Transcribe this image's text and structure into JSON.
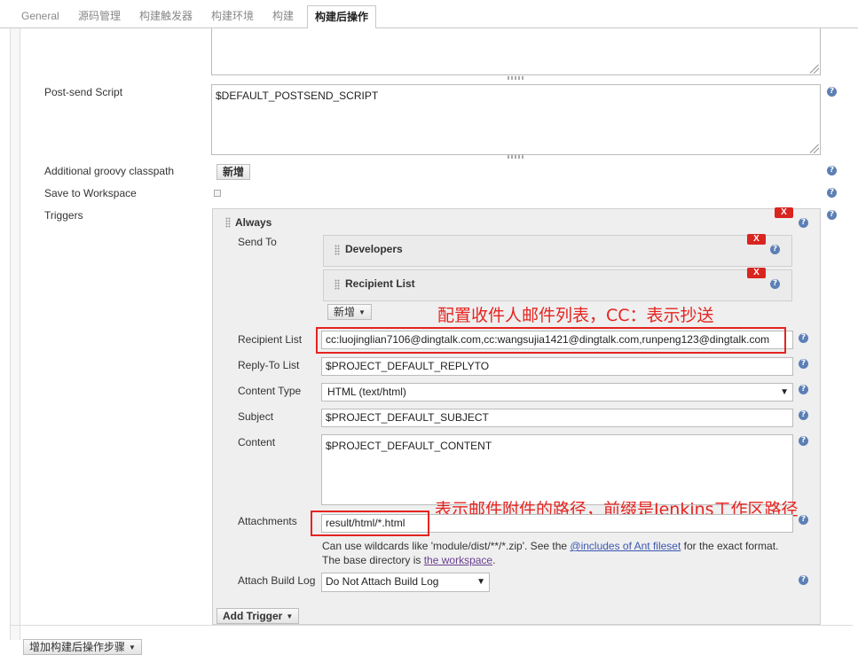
{
  "tabs": [
    {
      "label": "General"
    },
    {
      "label": "源码管理"
    },
    {
      "label": "构建触发器"
    },
    {
      "label": "构建环境"
    },
    {
      "label": "构建"
    },
    {
      "label": "构建后操作"
    }
  ],
  "fields": {
    "post_send_label": "Post-send Script",
    "post_send_value": "$DEFAULT_POSTSEND_SCRIPT",
    "groovy_label": "Additional groovy classpath",
    "groovy_add": "新增",
    "save_ws_label": "Save to Workspace",
    "triggers_label": "Triggers"
  },
  "trigger": {
    "name": "Always",
    "send_to_label": "Send To",
    "send_to": [
      "Developers",
      "Recipient List"
    ],
    "add_label": "新增",
    "recipient_label": "Recipient List",
    "recipient_value": "cc:luojinglian7106@dingtalk.com,cc:wangsujia1421@dingtalk.com,runpeng123@dingtalk.com",
    "replyto_label": "Reply-To List",
    "replyto_value": "$PROJECT_DEFAULT_REPLYTO",
    "content_type_label": "Content Type",
    "content_type_value": "HTML (text/html)",
    "subject_label": "Subject",
    "subject_value": "$PROJECT_DEFAULT_SUBJECT",
    "content_label": "Content",
    "content_value": "$PROJECT_DEFAULT_CONTENT",
    "attachments_label": "Attachments",
    "attachments_value": "result/html/*.html",
    "help1_prefix": "Can use wildcards like 'module/dist/**/*.zip'. See the ",
    "help1_link": "@includes of Ant fileset",
    "help1_suffix": " for the exact format.",
    "help2_prefix": "The base directory is ",
    "help2_link": "the workspace",
    "help2_suffix": ".",
    "attach_log_label": "Attach Build Log",
    "attach_log_value": "Do Not Attach Build Log",
    "add_trigger": "Add Trigger"
  },
  "add_post_build_step": "增加构建后操作步骤",
  "annotations": {
    "recipients_note": "配置收件人邮件列表，CC：表示抄送",
    "attachments_note": "表示邮件附件的路径，前缀是Jenkins工作区路径"
  },
  "icons": {
    "help": "?",
    "delete": "X",
    "caret": "▼"
  },
  "colors": {
    "annotation": "#e52420",
    "delete_button": "#d9251f",
    "help_icon": "#5c7fb5",
    "link": "#3a57b0"
  }
}
